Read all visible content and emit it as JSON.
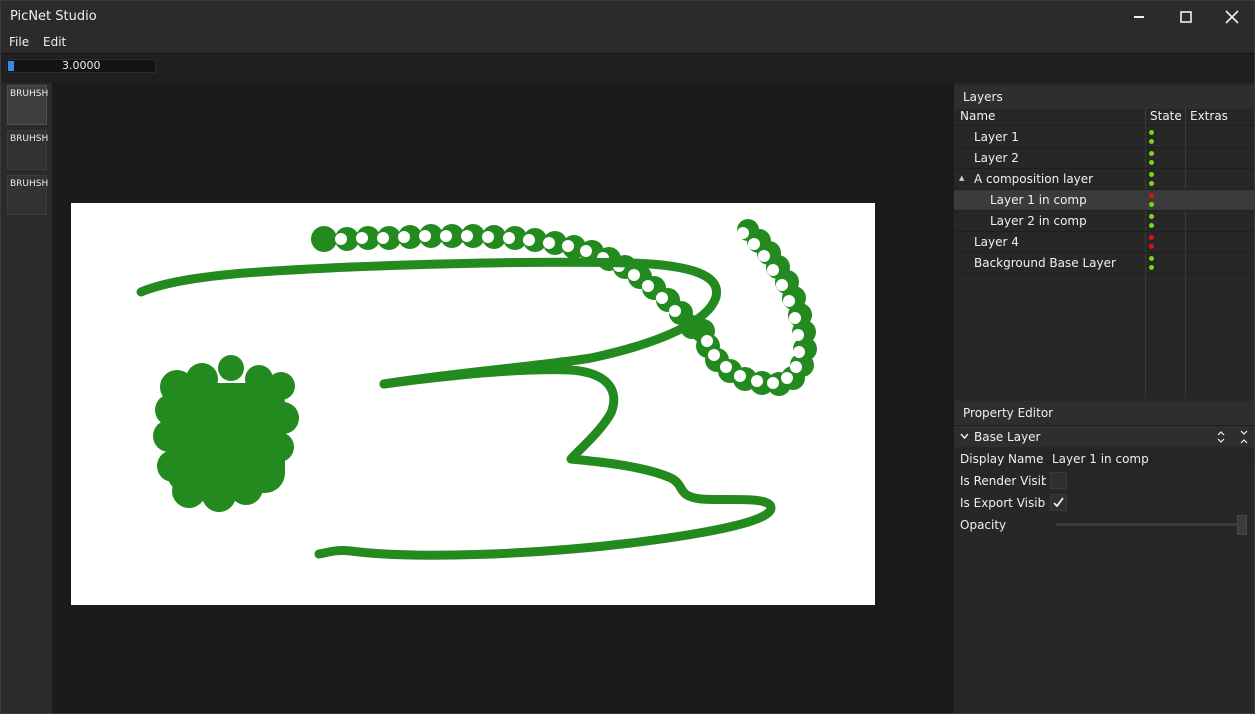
{
  "app": {
    "title": "PicNet Studio"
  },
  "window_controls": {
    "minimize_icon": "minimize-icon",
    "maximize_icon": "maximize-icon",
    "close_icon": "close-icon"
  },
  "menu": {
    "items": [
      "File",
      "Edit"
    ]
  },
  "toolbar": {
    "brush_size_value": "3.0000",
    "brush_size_fill_fraction": 0.04
  },
  "brushes": [
    {
      "label": "BRUHSH"
    },
    {
      "label": "BRUHSH"
    },
    {
      "label": "BRUHSH"
    }
  ],
  "layers": {
    "title": "Layers",
    "columns": [
      "Name",
      "State",
      "Extras"
    ],
    "rows": [
      {
        "name": "Layer 1",
        "render_visible": true,
        "export_visible": true
      },
      {
        "name": "Layer 2",
        "render_visible": true,
        "export_visible": true
      },
      {
        "name": "A composition layer",
        "expander": "▲",
        "render_visible": true,
        "export_visible": true
      },
      {
        "name": "Layer 1 in comp",
        "render_visible": false,
        "export_visible": true,
        "selected": true
      },
      {
        "name": "Layer 2 in comp",
        "render_visible": true,
        "export_visible": true
      },
      {
        "name": "Layer 4",
        "render_visible": false,
        "export_visible": false
      },
      {
        "name": "Background Base Layer",
        "render_visible": true,
        "export_visible": true
      }
    ]
  },
  "property_editor": {
    "title": "Property Editor",
    "section": "Base Layer",
    "properties": {
      "display_name_label": "Display Name",
      "display_name_value": "Layer 1 in comp",
      "render_visible_label": "Is Render Visible",
      "render_visible_checked": false,
      "export_visible_label": "Is Export Visible",
      "export_visible_checked": true,
      "opacity_label": "Opacity",
      "opacity_value": 1.0
    }
  },
  "colors": {
    "stroke_green": "#238a1f",
    "dot_on": "#7bd61a",
    "dot_off": "#e01010",
    "accent_blue": "#2f8de4"
  }
}
